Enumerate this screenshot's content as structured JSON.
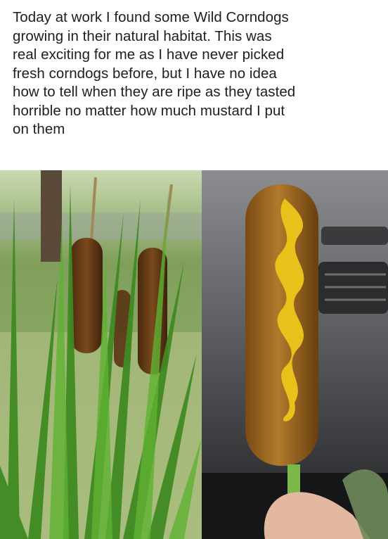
{
  "post": {
    "text": "Today at work I found some Wild Corndogs\ngrowing in their natural habitat. This was\nreal exciting for me as I have never picked\nfresh corndogs before, but I have no idea\nhow to tell when they are ripe as they tasted\nhorrible no matter how much mustard I put\non them"
  },
  "images": [
    {
      "name": "cattails-photo",
      "subject": "cattail plants"
    },
    {
      "name": "corndog-photo",
      "subject": "corndog with mustard"
    }
  ],
  "colors": {
    "text": "#1c1e21",
    "grass": "#4f8a2a",
    "cattail": "#6b3f18",
    "corndog": "#a66a22",
    "mustard": "#e8c21a",
    "dashboard": "#4d4f52"
  }
}
